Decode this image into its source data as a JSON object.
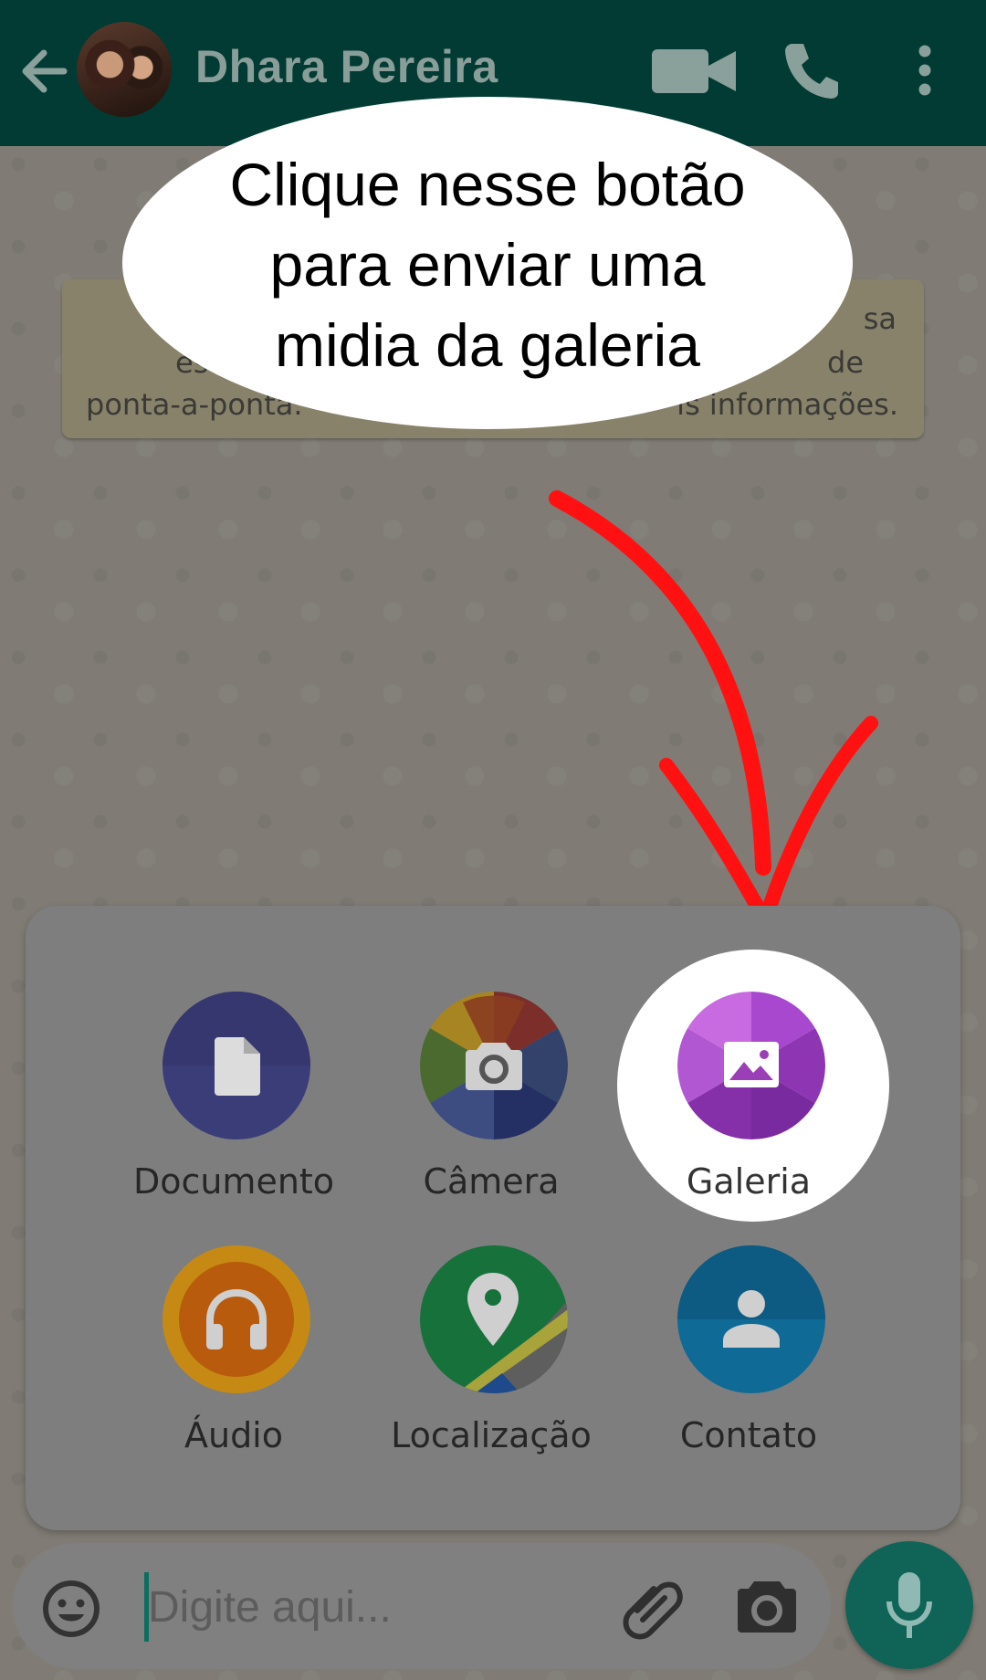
{
  "header": {
    "contact_name": "Dhara Pereira",
    "back_icon": "arrow-left-icon",
    "actions": [
      "video-call-icon",
      "phone-icon",
      "more-vert-icon"
    ],
    "colors": {
      "bar": "#013b33",
      "name": "#8a9e99"
    }
  },
  "notice": {
    "lines": [
      "sa",
      "es",
      "de",
      "ponta-a-ponta.",
      "is informações."
    ]
  },
  "callout": {
    "lines": [
      "Clique nesse botão",
      "para enviar uma",
      "midia da galeria"
    ]
  },
  "attach_menu": {
    "items": [
      {
        "label": "Documento",
        "icon": "document-icon",
        "color": "#3b3d78"
      },
      {
        "label": "Câmera",
        "icon": "camera-icon",
        "color": "#4a6a35"
      },
      {
        "label": "Galeria",
        "icon": "gallery-icon",
        "color": "#9b3fb6"
      },
      {
        "label": "Áudio",
        "icon": "headphones-icon",
        "color": "#c16a10"
      },
      {
        "label": "Localização",
        "icon": "location-pin-icon",
        "color": "#17713a"
      },
      {
        "label": "Contato",
        "icon": "person-icon",
        "color": "#0f5a82"
      }
    ]
  },
  "input_bar": {
    "placeholder": "Digite aqui...",
    "emoji_icon": "emoji-icon",
    "attach_icon": "paperclip-icon",
    "camera_icon": "camera-icon",
    "mic_icon": "microphone-icon",
    "colors": {
      "mic": "#0f6357"
    }
  }
}
